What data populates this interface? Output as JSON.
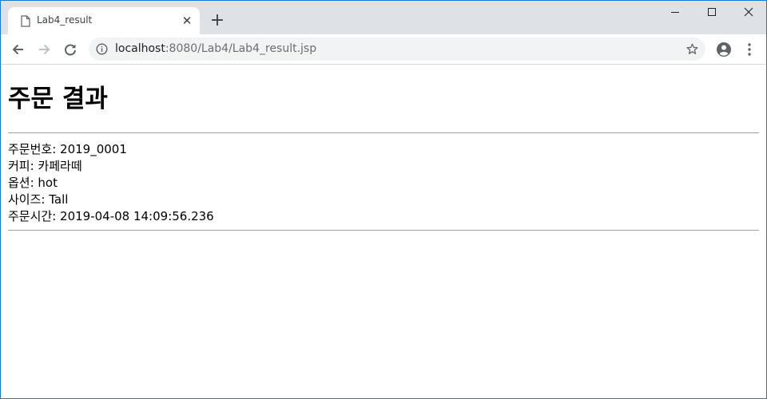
{
  "browser": {
    "tab": {
      "title": "Lab4_result",
      "icon": "page-icon"
    },
    "url": {
      "host": "localhost",
      "rest": ":8080/Lab4/Lab4_result.jsp"
    }
  },
  "page": {
    "title": "주문 결과",
    "lines": [
      {
        "label": "주문번호",
        "value": "2019_0001",
        "text": "주문번호: 2019_0001"
      },
      {
        "label": "커피",
        "value": "카페라떼",
        "text": "커피: 카페라떼"
      },
      {
        "label": "옵션",
        "value": "hot",
        "text": "옵션: hot"
      },
      {
        "label": "사이즈",
        "value": "Tall",
        "text": "사이즈: Tall"
      },
      {
        "label": "주문시간",
        "value": "2019-04-08 14:09:56.236",
        "text": "주문시간: 2019-04-08 14:09:56.236"
      }
    ]
  },
  "colors": {
    "tabstrip": "#dee1e6",
    "omnibox": "#f1f3f4",
    "window_border": "#1f78c8",
    "rule": "#a0a0a0"
  }
}
